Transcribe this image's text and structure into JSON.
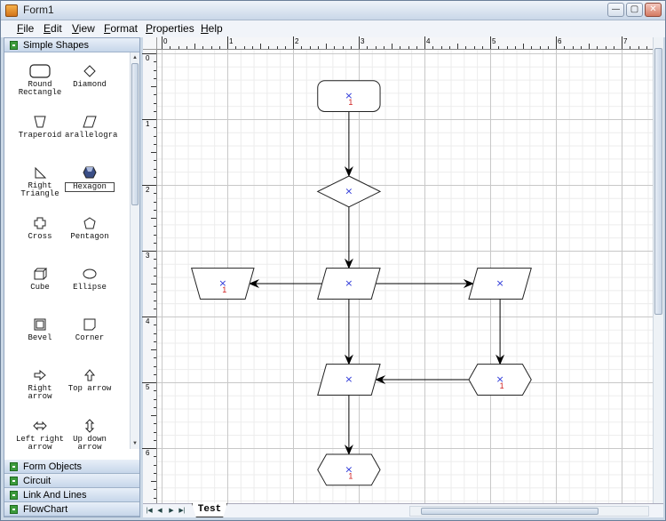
{
  "window": {
    "title": "Form1",
    "min": "—",
    "max": "▢",
    "close": "✕"
  },
  "menu": [
    {
      "key": "F",
      "rest": "ile"
    },
    {
      "key": "E",
      "rest": "dit"
    },
    {
      "key": "V",
      "rest": "iew"
    },
    {
      "key": "F",
      "rest": "ormat"
    },
    {
      "key": "P",
      "rest": "roperties"
    },
    {
      "key": "H",
      "rest": "elp"
    }
  ],
  "palette": {
    "active_group": "Simple Shapes",
    "shapes": [
      {
        "label1": "Round",
        "label2": "Rectangle",
        "icon": "round-rectangle-icon"
      },
      {
        "label1": "Diamond",
        "label2": "",
        "icon": "diamond-icon"
      },
      {
        "label1": "Traperoid",
        "label2": "",
        "icon": "trapezoid-icon"
      },
      {
        "label1": "arallelogra",
        "label2": "",
        "icon": "parallelogram-icon"
      },
      {
        "label1": "Right",
        "label2": "Triangle",
        "icon": "right-triangle-icon"
      },
      {
        "label1": "Hexagon",
        "label2": "",
        "icon": "hexagon-icon",
        "selected": true
      },
      {
        "label1": "Cross",
        "label2": "",
        "icon": "cross-icon"
      },
      {
        "label1": "Pentagon",
        "label2": "",
        "icon": "pentagon-icon"
      },
      {
        "label1": "Cube",
        "label2": "",
        "icon": "cube-icon"
      },
      {
        "label1": "Ellipse",
        "label2": "",
        "icon": "ellipse-icon"
      },
      {
        "label1": "Bevel",
        "label2": "",
        "icon": "bevel-icon"
      },
      {
        "label1": "Corner",
        "label2": "",
        "icon": "corner-icon"
      },
      {
        "label1": "Right",
        "label2": "arrow",
        "icon": "right-arrow-icon"
      },
      {
        "label1": "Top arrow",
        "label2": "",
        "icon": "top-arrow-icon"
      },
      {
        "label1": "Left right",
        "label2": "arrow",
        "icon": "left-right-arrow-icon"
      },
      {
        "label1": "Up down",
        "label2": "arrow",
        "icon": "up-down-arrow-icon"
      }
    ],
    "other_groups": [
      "Form Objects",
      "Circuit",
      "Link And Lines",
      "FlowChart"
    ]
  },
  "rulers": {
    "h": [
      "0",
      "1",
      "2",
      "3",
      "4",
      "5",
      "6",
      "7"
    ],
    "v": [
      "0",
      "1",
      "2",
      "3",
      "4",
      "5",
      "6"
    ]
  },
  "diagram": {
    "port_marker": "×",
    "label_mark": "1",
    "nodes": [
      {
        "id": "n1",
        "shape": "round-rectangle",
        "cx": 2.85,
        "cy": 0.65,
        "w": 0.95,
        "h": 0.47,
        "label": true
      },
      {
        "id": "n2",
        "shape": "diamond",
        "cx": 2.85,
        "cy": 2.1,
        "w": 0.95,
        "h": 0.47,
        "label": false
      },
      {
        "id": "n3",
        "shape": "parallelogram",
        "cx": 2.85,
        "cy": 3.5,
        "w": 0.95,
        "h": 0.47,
        "label": false
      },
      {
        "id": "n4",
        "shape": "trapezoid",
        "cx": 0.93,
        "cy": 3.5,
        "w": 0.95,
        "h": 0.47,
        "label": true
      },
      {
        "id": "n5",
        "shape": "parallelogram",
        "cx": 5.15,
        "cy": 3.5,
        "w": 0.95,
        "h": 0.47,
        "label": false
      },
      {
        "id": "n6",
        "shape": "parallelogram",
        "cx": 2.85,
        "cy": 4.96,
        "w": 0.95,
        "h": 0.47,
        "label": false
      },
      {
        "id": "n7",
        "shape": "hexagon",
        "cx": 5.15,
        "cy": 4.96,
        "w": 0.95,
        "h": 0.47,
        "label": true
      },
      {
        "id": "n8",
        "shape": "hexagon",
        "cx": 2.85,
        "cy": 6.33,
        "w": 0.95,
        "h": 0.47,
        "label": true
      }
    ],
    "edges": [
      {
        "from": "n1",
        "to": "n2",
        "dir": "down"
      },
      {
        "from": "n2",
        "to": "n3",
        "dir": "down"
      },
      {
        "from": "n3",
        "to": "n4",
        "dir": "left"
      },
      {
        "from": "n3",
        "to": "n5",
        "dir": "right"
      },
      {
        "from": "n3",
        "to": "n6",
        "dir": "down"
      },
      {
        "from": "n5",
        "to": "n7",
        "dir": "down"
      },
      {
        "from": "n7",
        "to": "n6",
        "dir": "left"
      },
      {
        "from": "n6",
        "to": "n8",
        "dir": "down"
      }
    ]
  },
  "sheet_tab": "Test",
  "colors": {
    "edge": "#000000",
    "port": "#2a35d8",
    "label_mark": "#d02020",
    "shape_stroke": "#222222",
    "shape_fill": "#ffffff"
  }
}
